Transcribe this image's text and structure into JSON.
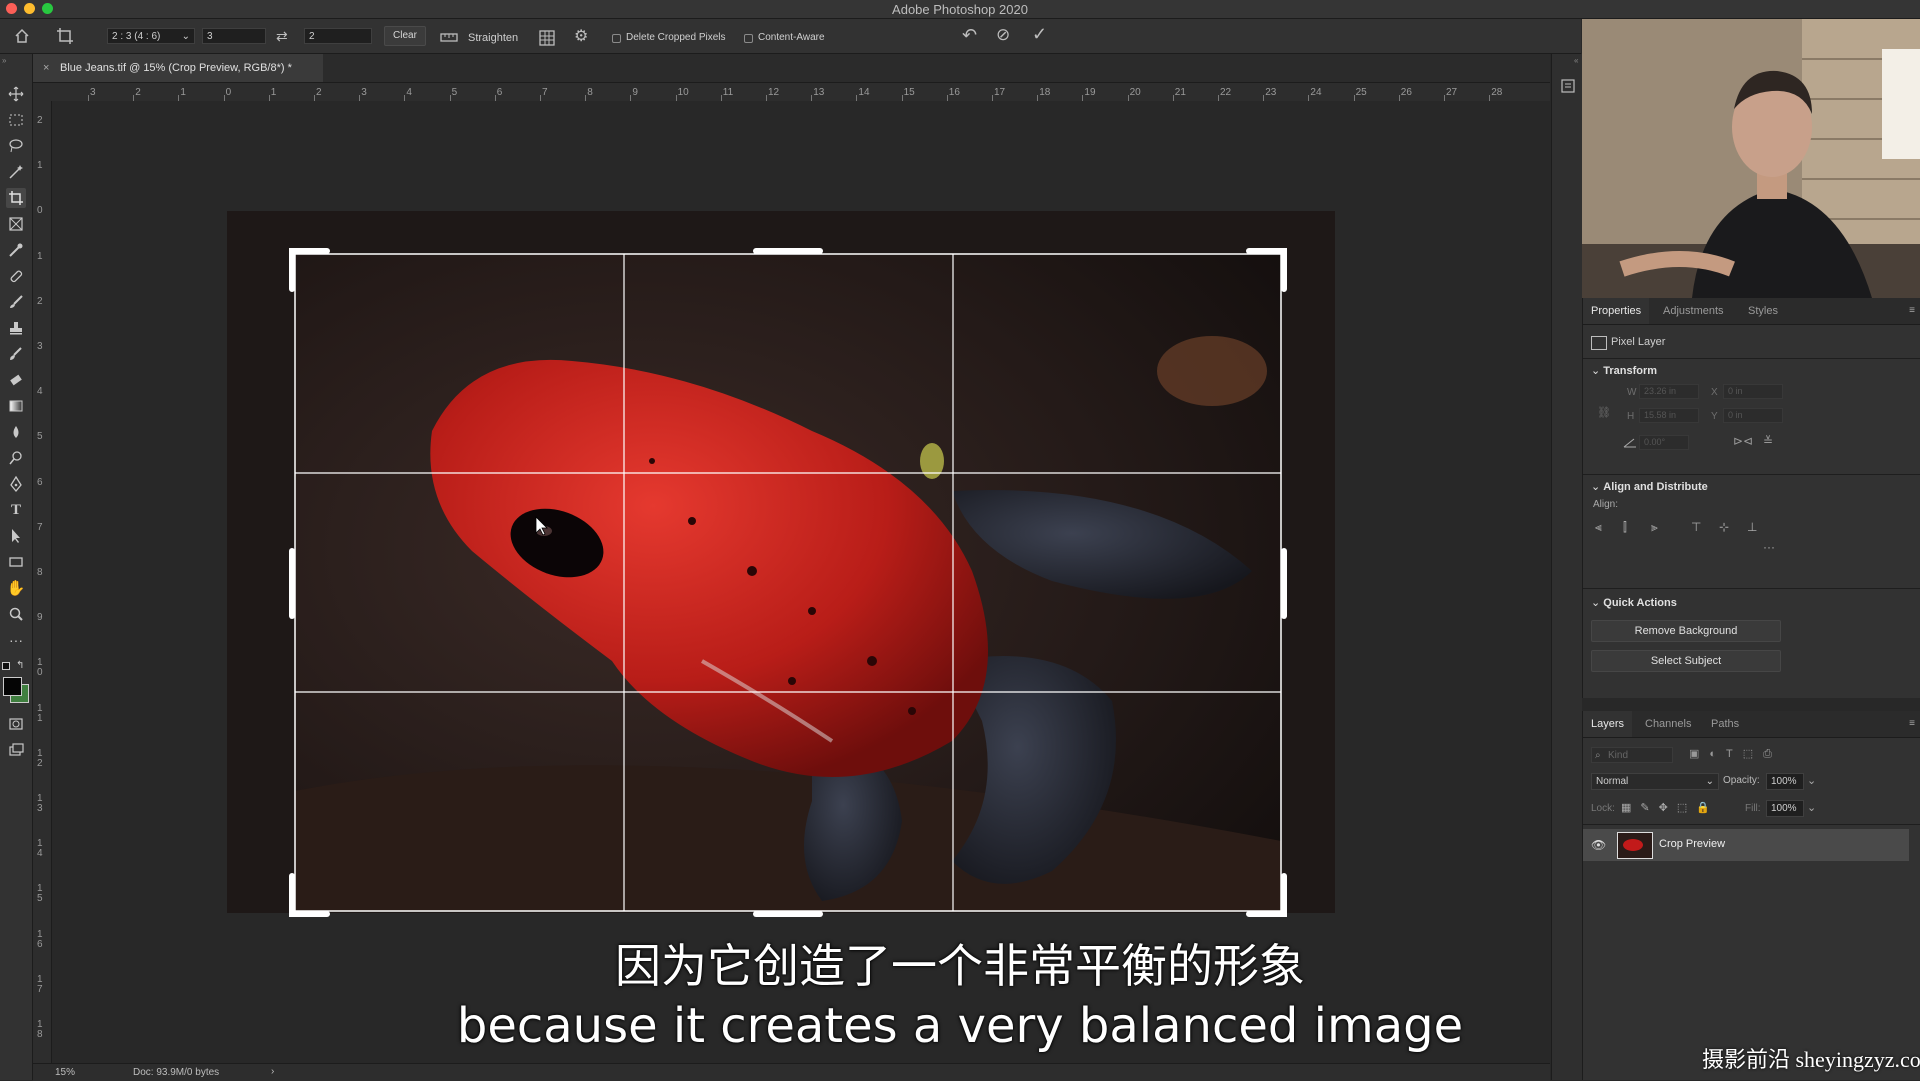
{
  "app": {
    "title": "Adobe Photoshop 2020"
  },
  "options_bar": {
    "ratio_preset": "2 : 3 (4 : 6)",
    "width_value": "3",
    "height_value": "2",
    "clear_label": "Clear",
    "straighten_label": "Straighten",
    "delete_cropped_label": "Delete Cropped Pixels",
    "content_aware_label": "Content-Aware"
  },
  "document": {
    "tab_title": "Blue Jeans.tif @ 15% (Crop Preview, RGB/8*) *",
    "zoom": "15%",
    "doc_info": "Doc: 93.9M/0 bytes"
  },
  "rulers": {
    "horizontal": [
      "3",
      "2",
      "1",
      "0",
      "1",
      "2",
      "3",
      "4",
      "5",
      "6",
      "7",
      "8",
      "9",
      "10",
      "11",
      "12",
      "13",
      "14",
      "15",
      "16",
      "17",
      "18",
      "19",
      "20",
      "21",
      "22",
      "23",
      "24",
      "25",
      "26",
      "27",
      "28"
    ],
    "vertical": [
      "2",
      "1",
      "0",
      "1",
      "2",
      "3",
      "4",
      "5",
      "6",
      "7",
      "8",
      "9",
      "10",
      "11",
      "12",
      "13",
      "14",
      "15",
      "16",
      "17",
      "18"
    ]
  },
  "properties_panel": {
    "tabs": [
      "Properties",
      "Adjustments",
      "Styles"
    ],
    "layer_type": "Pixel Layer",
    "transform": {
      "title": "Transform",
      "w": "W",
      "h": "H",
      "x": "X",
      "y": "Y",
      "w_val": "23.26 in",
      "h_val": "15.58 in",
      "x_val": "0 in",
      "y_val": "0 in",
      "angle_val": "0.00°"
    },
    "align": {
      "title": "Align and Distribute",
      "label": "Align:"
    },
    "quick_actions": {
      "title": "Quick Actions",
      "remove_background": "Remove Background",
      "select_subject": "Select Subject"
    }
  },
  "layers_panel": {
    "tabs": [
      "Layers",
      "Channels",
      "Paths"
    ],
    "filter_placeholder": "Kind",
    "blend_mode": "Normal",
    "opacity_label": "Opacity:",
    "opacity_value": "100%",
    "lock_label": "Lock:",
    "fill_label": "Fill:",
    "fill_value": "100%",
    "layers": [
      {
        "name": "Crop Preview",
        "visible": true
      }
    ]
  },
  "subtitles": {
    "zh": "因为它创造了一个非常平衡的形象",
    "en": "because it creates a very balanced image"
  },
  "watermark": "摄影前沿 sheyingzyz.com",
  "colors": {
    "accent": "#2f7fd8",
    "frog_red": "#c21a1a"
  }
}
